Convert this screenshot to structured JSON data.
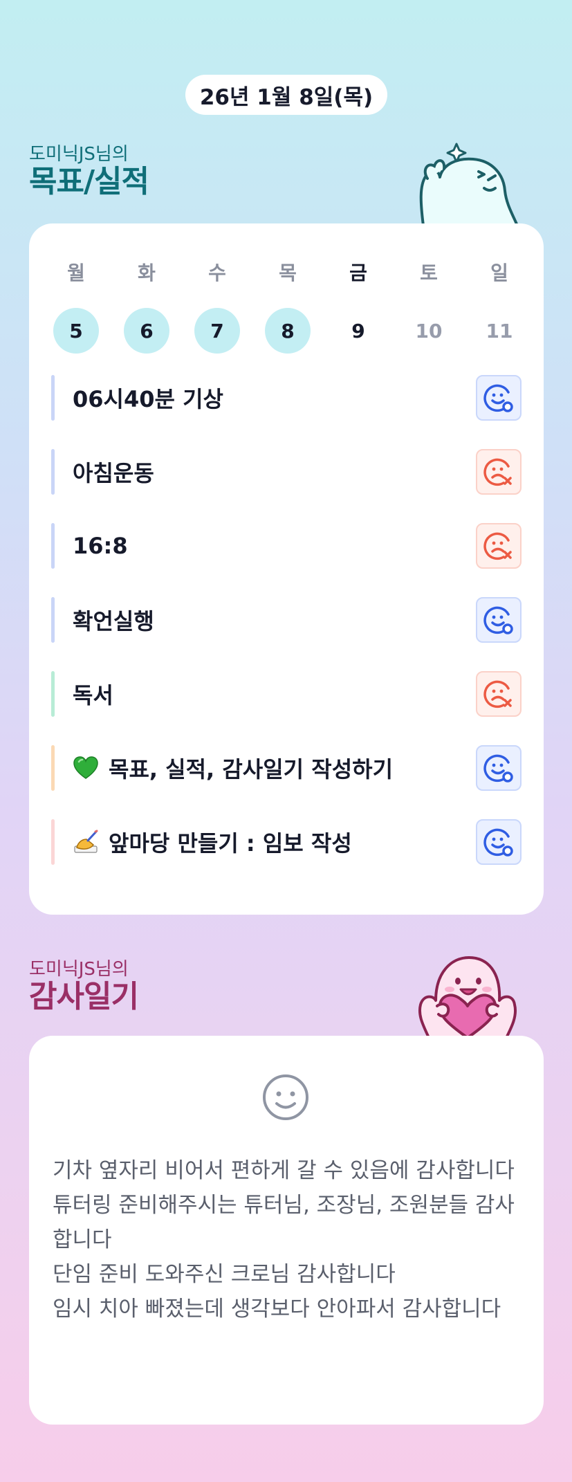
{
  "date_label": "26년 1월 8일(목)",
  "goals_section": {
    "owner": "도미닉JS님의",
    "title": "목표/실적"
  },
  "week": {
    "days": [
      {
        "name": "월",
        "num": "5",
        "state": "done"
      },
      {
        "name": "화",
        "num": "6",
        "state": "done"
      },
      {
        "name": "수",
        "num": "7",
        "state": "done"
      },
      {
        "name": "목",
        "num": "8",
        "state": "done"
      },
      {
        "name": "금",
        "num": "9",
        "state": "today"
      },
      {
        "name": "토",
        "num": "10",
        "state": "future"
      },
      {
        "name": "일",
        "num": "11",
        "state": "future"
      }
    ]
  },
  "goals": [
    {
      "text": "06시40분 기상",
      "status": "done",
      "bar_color": "#c9d5f7"
    },
    {
      "text": "아침운동",
      "status": "failed",
      "bar_color": "#c9d5f7"
    },
    {
      "text": "16:8",
      "status": "failed",
      "bar_color": "#c9d5f7"
    },
    {
      "text": "확언실행",
      "status": "done",
      "bar_color": "#c9d5f7"
    },
    {
      "text": "독서",
      "status": "failed",
      "bar_color": "#b8ecd6"
    },
    {
      "text": "목표, 실적, 감사일기 작성하기",
      "status": "done",
      "bar_color": "#fbd9b4",
      "icon": "green-heart-icon"
    },
    {
      "text": "앞마당 만들기 : 임보 작성",
      "status": "done",
      "bar_color": "#fbd6d6",
      "icon": "writing-hand-icon"
    }
  ],
  "gratitude_section": {
    "owner": "도미닉JS님의",
    "title": "감사일기"
  },
  "gratitude": {
    "mood_icon": "smile-face-icon",
    "text": "기차 옆자리 비어서 편하게 갈 수 있음에 감사합니다\n튜터링 준비해주시는 튜터님, 조장님, 조원분들 감사합니다\n단임 준비 도와주신 크로님 감사합니다\n임시 치아 빠졌는데 생각보다 안아파서 감사합니다"
  },
  "colors": {
    "done_blue": "#2f5de3",
    "failed_red": "#ec5a43",
    "done_day_bg": "#c3eef3",
    "goals_title": "#0f6e78",
    "gratitude_title": "#9a2f66"
  }
}
